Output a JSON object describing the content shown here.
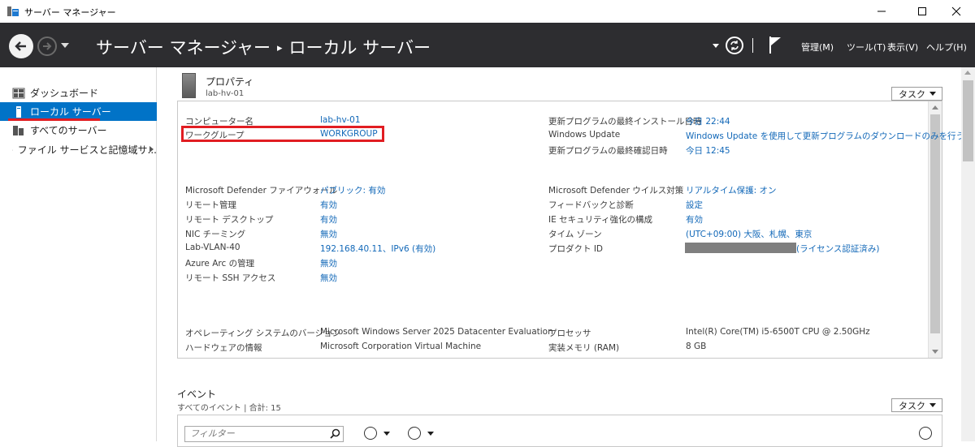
{
  "window": {
    "title": "サーバー マネージャー"
  },
  "header": {
    "breadcrumb_root": "サーバー マネージャー",
    "breadcrumb_sep": "▸",
    "breadcrumb_current": "ローカル サーバー",
    "menus": [
      "管理(M)",
      "ツール(T)",
      "表示(V)",
      "ヘルプ(H)"
    ]
  },
  "sidebar": {
    "items": [
      {
        "label": "ダッシュボード",
        "icon": "dashboard-icon"
      },
      {
        "label": "ローカル サーバー",
        "icon": "local-server-icon",
        "active": true
      },
      {
        "label": "すべてのサーバー",
        "icon": "all-servers-icon"
      },
      {
        "label": "ファイル サービスと記憶域サ...",
        "icon": "file-services-icon"
      }
    ]
  },
  "properties": {
    "title": "プロパティ",
    "subtitle": "lab-hv-01",
    "task_label": "タスク",
    "left_rows": [
      {
        "label": "コンピューター名",
        "value": "lab-hv-01"
      },
      {
        "label": "ワークグループ",
        "value": "WORKGROUP"
      },
      {
        "label": "Microsoft Defender ファイアウォール",
        "value": "パブリック: 有効"
      },
      {
        "label": "リモート管理",
        "value": "有効"
      },
      {
        "label": "リモート デスクトップ",
        "value": "有効"
      },
      {
        "label": "NIC チーミング",
        "value": "無効"
      },
      {
        "label": "Lab-VLAN-40",
        "value": "192.168.40.11、IPv6 (有効)"
      },
      {
        "label": "Azure Arc の管理",
        "value": "無効"
      },
      {
        "label": "リモート SSH アクセス",
        "value": "無効"
      },
      {
        "label": "オペレーティング システムのバージョン",
        "value": "Microsoft Windows Server 2025 Datacenter Evaluation"
      },
      {
        "label": "ハードウェアの情報",
        "value": "Microsoft Corporation Virtual Machine"
      }
    ],
    "right_rows": [
      {
        "label": "更新プログラムの最終インストール日時",
        "value": "今日 22:44"
      },
      {
        "label": "Windows Update",
        "value": "Windows Update を使用して更新プログラムのダウンロードのみを行う"
      },
      {
        "label": "更新プログラムの最終確認日時",
        "value": "今日 12:45"
      },
      {
        "label": "Microsoft Defender ウイルス対策",
        "value": "リアルタイム保護: オン"
      },
      {
        "label": "フィードバックと診断",
        "value": "設定"
      },
      {
        "label": "IE セキュリティ強化の構成",
        "value": "有効"
      },
      {
        "label": "タイム ゾーン",
        "value": "(UTC+09:00) 大阪、札幌、東京"
      },
      {
        "label": "プロダクト ID",
        "value": "(ライセンス認証済み)"
      },
      {
        "label": "プロセッサ",
        "value": "Intel(R) Core(TM) i5-6500T CPU @ 2.50GHz"
      },
      {
        "label": "実装メモリ (RAM)",
        "value": "8 GB"
      }
    ]
  },
  "events": {
    "title": "イベント",
    "subtitle": "すべてのイベント | 合計: 15",
    "task_label": "タスク",
    "filter_placeholder": "フィルター"
  }
}
